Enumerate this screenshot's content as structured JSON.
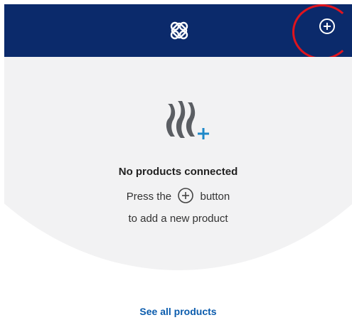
{
  "header": {
    "logo_icon": "knot-logo-icon",
    "add_icon": "plus-circle-icon",
    "background": "#0b2a6b",
    "highlight_color": "#e0141d"
  },
  "empty_state": {
    "icon": "product-add-icon",
    "title": "No products connected",
    "hint_before": "Press the",
    "hint_after": "button",
    "hint_line2": "to add a new product"
  },
  "footer": {
    "see_all_label": "See all products",
    "link_color": "#0b5cad"
  }
}
